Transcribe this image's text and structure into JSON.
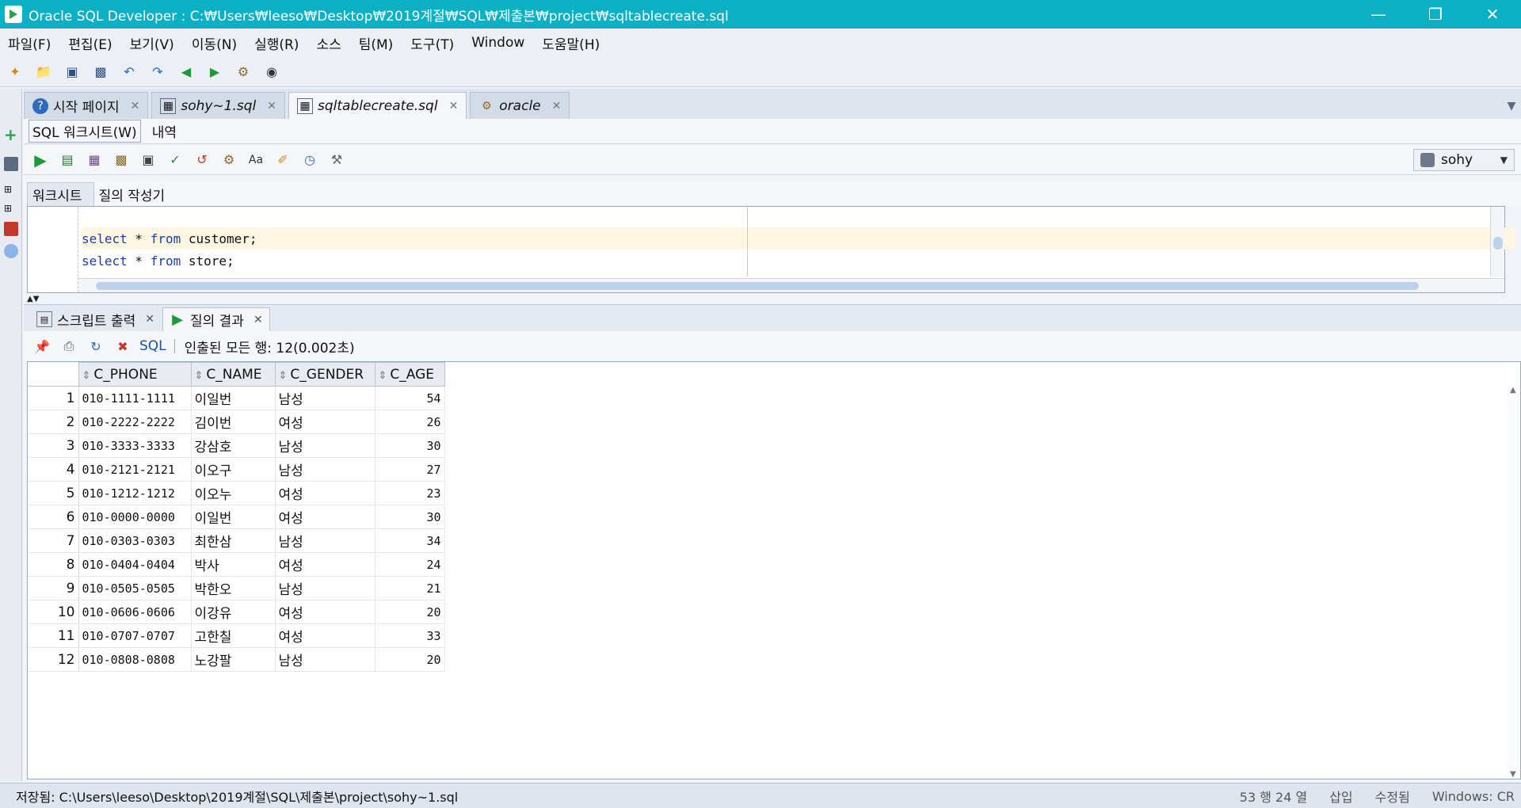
{
  "window": {
    "title": "Oracle SQL Developer : C:₩Users₩leeso₩Desktop₩2019계절₩SQL₩제출본₩project₩sqltablecreate.sql",
    "minimize": "—",
    "restore": "❐",
    "close": "✕"
  },
  "menu": [
    "파일(F)",
    "편집(E)",
    "보기(V)",
    "이동(N)",
    "실행(R)",
    "소스",
    "팀(M)",
    "도구(T)",
    "Window",
    "도움말(H)"
  ],
  "doc_tabs": [
    {
      "label": "시작 페이지",
      "icon": "help-icon"
    },
    {
      "label": "sohy~1.sql",
      "icon": "sql-file-icon"
    },
    {
      "label": "sqltablecreate.sql",
      "icon": "sql-file-icon",
      "active": true
    },
    {
      "label": "oracle",
      "icon": "connection-icon"
    }
  ],
  "sub_tabs": {
    "worksheet": "SQL 워크시트(W)",
    "history": "내역"
  },
  "connection": {
    "name": "sohy"
  },
  "editor_tabs": {
    "worksheet": "워크시트",
    "query_builder": "질의 작성기"
  },
  "editor": {
    "lines": [
      {
        "kw1": "select",
        "rest1": " * ",
        "kw2": "from",
        "rest2": " customer;"
      },
      {
        "kw1": "select",
        "rest1": " * ",
        "kw2": "from",
        "rest2": " store;"
      }
    ]
  },
  "results": {
    "tabs": {
      "script_output": "스크립트 출력",
      "query_result": "질의 결과"
    },
    "sql_label": "SQL",
    "status": "인출된 모든 행: 12(0.002초)",
    "columns": [
      "C_PHONE",
      "C_NAME",
      "C_GENDER",
      "C_AGE"
    ],
    "rows": [
      [
        "1",
        "010-1111-1111",
        "이일번",
        "남성",
        "54"
      ],
      [
        "2",
        "010-2222-2222",
        "김이번",
        "여성",
        "26"
      ],
      [
        "3",
        "010-3333-3333",
        "강삼호",
        "남성",
        "30"
      ],
      [
        "4",
        "010-2121-2121",
        "이오구",
        "남성",
        "27"
      ],
      [
        "5",
        "010-1212-1212",
        "이오누",
        "여성",
        "23"
      ],
      [
        "6",
        "010-0000-0000",
        "이일번",
        "여성",
        "30"
      ],
      [
        "7",
        "010-0303-0303",
        "최한삼",
        "남성",
        "34"
      ],
      [
        "8",
        "010-0404-0404",
        "박사",
        "여성",
        "24"
      ],
      [
        "9",
        "010-0505-0505",
        "박한오",
        "남성",
        "21"
      ],
      [
        "10",
        "010-0606-0606",
        "이강유",
        "여성",
        "20"
      ],
      [
        "11",
        "010-0707-0707",
        "고한칠",
        "여성",
        "33"
      ],
      [
        "12",
        "010-0808-0808",
        "노강팔",
        "남성",
        "20"
      ]
    ]
  },
  "statusbar": {
    "saved": "저장됨: C:\\Users\\leeso\\Desktop\\2019계절\\SQL\\제출본\\project\\sohy~1.sql",
    "position": "53 행 24 열",
    "insert": "삽입",
    "modified": "수정됨",
    "eol": "Windows: CR"
  },
  "colors": {
    "titlebar": "#0ab1c4",
    "keyword": "#1a3ea8",
    "current_line": "#fdf7e2"
  }
}
